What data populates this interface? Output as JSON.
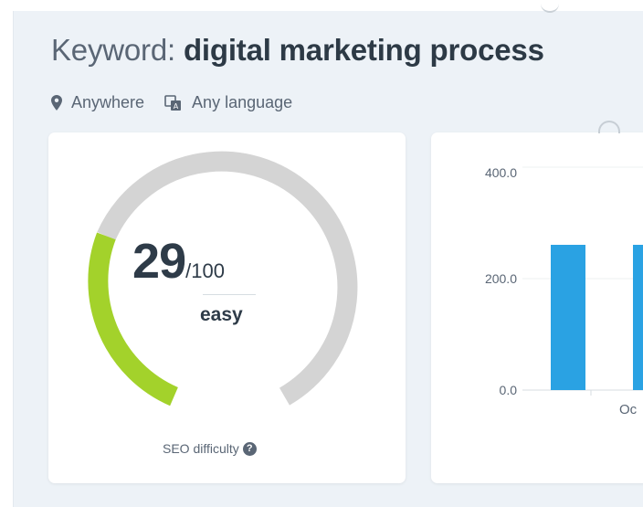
{
  "header": {
    "title_prefix": "Keyword:",
    "keyword": "digital marketing process",
    "location": {
      "label": "Anywhere",
      "icon": "map-pin-icon"
    },
    "language": {
      "label": "Any language",
      "icon": "language-icon"
    }
  },
  "seo_difficulty": {
    "score": "29",
    "max": "/100",
    "score_value": 29,
    "max_value": 100,
    "rating": "easy",
    "label": "SEO difficulty",
    "help_icon": "question-circle-icon",
    "colors": {
      "filled": "#a3d22b",
      "track": "#d4d4d4"
    }
  },
  "chart_data": {
    "type": "bar",
    "categories": [
      "",
      ""
    ],
    "values": [
      260,
      260
    ],
    "yticks": [
      "400.0",
      "200.0",
      "0.0"
    ],
    "ylim": [
      0,
      400
    ],
    "xlabel_visible": "Oc",
    "color": "#2aa2e3",
    "grid": true
  }
}
